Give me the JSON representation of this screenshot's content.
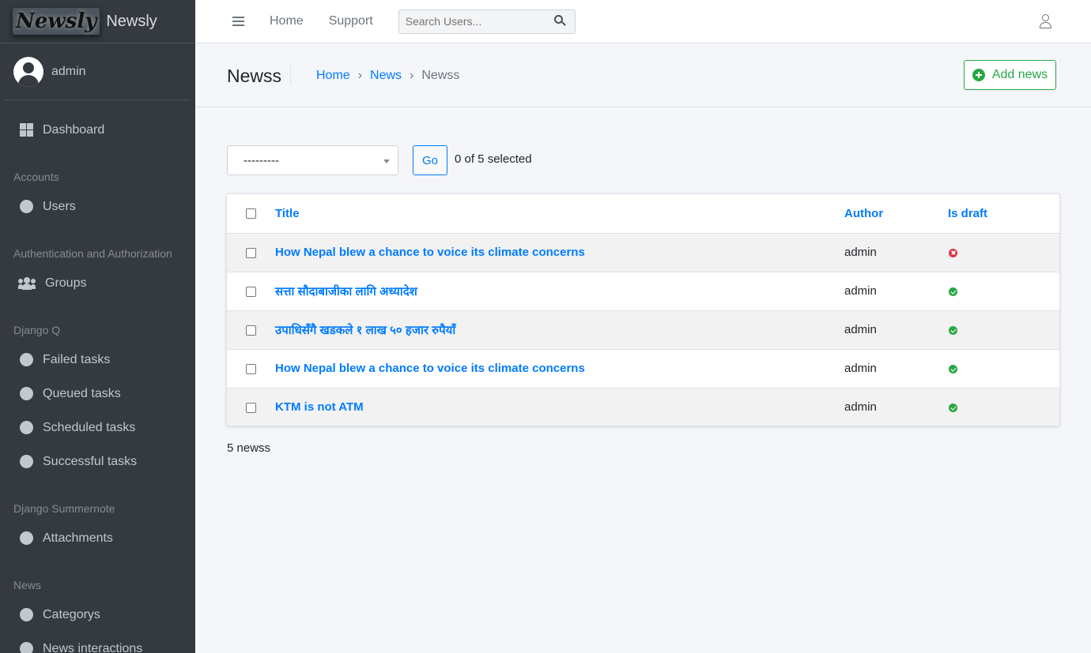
{
  "brand": {
    "logo_text": "Newsly",
    "name": "Newsly"
  },
  "user": {
    "name": "admin"
  },
  "sidebar": {
    "dashboard": "Dashboard",
    "sections": [
      {
        "header": "Accounts",
        "items": [
          "Users"
        ]
      },
      {
        "header": "Authentication and Authorization",
        "items": [
          "Groups"
        ]
      },
      {
        "header": "Django Q",
        "items": [
          "Failed tasks",
          "Queued tasks",
          "Scheduled tasks",
          "Successful tasks"
        ]
      },
      {
        "header": "Django Summernote",
        "items": [
          "Attachments"
        ]
      },
      {
        "header": "News",
        "items": [
          "Categorys",
          "News interactions"
        ]
      }
    ]
  },
  "topbar": {
    "links": [
      "Home",
      "Support"
    ],
    "search_placeholder": "Search Users..."
  },
  "header": {
    "title": "Newss",
    "breadcrumb": [
      "Home",
      "News",
      "Newss"
    ],
    "add_label": "Add news"
  },
  "actions": {
    "select_value": "---------",
    "go_label": "Go",
    "selected_text": "0 of 5 selected"
  },
  "table": {
    "columns": [
      "Title",
      "Author",
      "Is draft"
    ],
    "rows": [
      {
        "title": "How Nepal blew a chance to voice its climate concerns",
        "author": "admin",
        "is_draft": false
      },
      {
        "title": "सत्ता सौदाबाजीका लागि अध्यादेश",
        "author": "admin",
        "is_draft": true
      },
      {
        "title": "उपाधिसँगै खडकले १ लाख ५० हजार रुपैयाँ",
        "author": "admin",
        "is_draft": true
      },
      {
        "title": "How Nepal blew a chance to voice its climate concerns",
        "author": "admin",
        "is_draft": true
      },
      {
        "title": "KTM is not ATM",
        "author": "admin",
        "is_draft": true
      }
    ]
  },
  "result_count": "5 newss",
  "colors": {
    "sidebar_bg": "#343a40",
    "link": "#007bff",
    "success": "#28a745",
    "danger": "#dc3545"
  }
}
